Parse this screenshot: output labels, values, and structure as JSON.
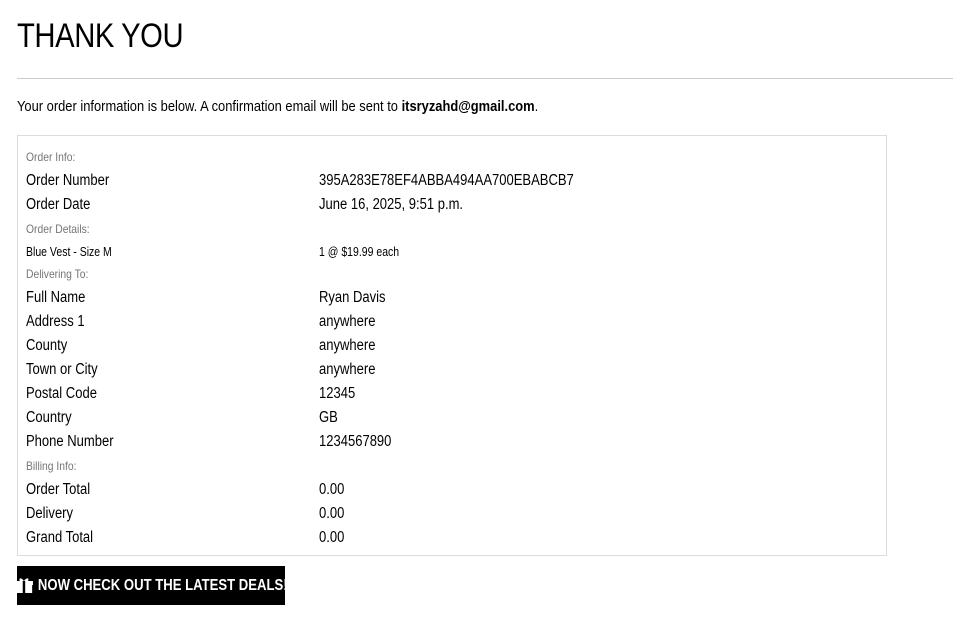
{
  "page_title": "THANK YOU",
  "intro": {
    "prefix": "Your order information is below. A confirmation email will be sent to",
    "email": "itsryzahd@gmail.com",
    "suffix": "."
  },
  "order_info": {
    "heading": "Order Info:",
    "rows": [
      {
        "label": "Order Number",
        "value": "395A283E78EF4ABBA494AA700EBABCB7"
      },
      {
        "label": "Order Date",
        "value": "June 16, 2025, 9:51 p.m."
      }
    ]
  },
  "order_details": {
    "heading": "Order Details:",
    "items": [
      {
        "label": "Blue Vest - Size M",
        "value": "1 @ $19.99 each"
      }
    ]
  },
  "delivering_to": {
    "heading": "Delivering To:",
    "rows": [
      {
        "label": "Full Name",
        "value": "Ryan Davis"
      },
      {
        "label": "Address 1",
        "value": "anywhere"
      },
      {
        "label": "County",
        "value": "anywhere"
      },
      {
        "label": "Town or City",
        "value": "anywhere"
      },
      {
        "label": "Postal Code",
        "value": "12345"
      },
      {
        "label": "Country",
        "value": "GB"
      },
      {
        "label": "Phone Number",
        "value": "1234567890"
      }
    ]
  },
  "billing_info": {
    "heading": "Billing Info:",
    "rows": [
      {
        "label": "Order Total",
        "value": "0.00"
      },
      {
        "label": "Delivery",
        "value": "0.00"
      },
      {
        "label": "Grand Total",
        "value": "0.00"
      }
    ]
  },
  "cta": {
    "label": "Now Check Out The Latest Deals!",
    "icon": "gift-icon"
  }
}
